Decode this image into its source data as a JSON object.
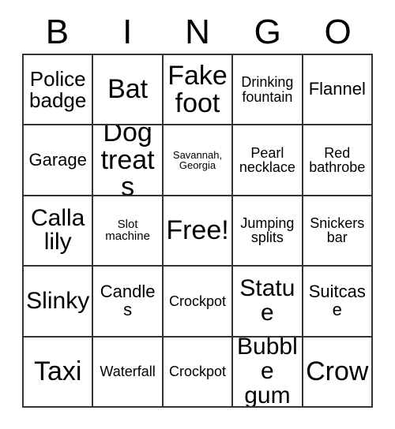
{
  "card": {
    "title": "BINGO",
    "headers": [
      "B",
      "I",
      "N",
      "G",
      "O"
    ],
    "colors": {
      "text": "#000000",
      "border": "#333333",
      "background": "#ffffff"
    },
    "rows": [
      [
        {
          "label": "Police badge",
          "size": "lg"
        },
        {
          "label": "Bat",
          "size": "xxl"
        },
        {
          "label": "Fake foot",
          "size": "xxl"
        },
        {
          "label": "Drinking fountain",
          "size": "sm"
        },
        {
          "label": "Flannel",
          "size": "md"
        }
      ],
      [
        {
          "label": "Garage",
          "size": "md"
        },
        {
          "label": "Dog treats",
          "size": "xxl"
        },
        {
          "label": "Savannah, Georgia",
          "size": "xxs"
        },
        {
          "label": "Pearl necklace",
          "size": "sm"
        },
        {
          "label": "Red bathrobe",
          "size": "sm"
        }
      ],
      [
        {
          "label": "Calla lily",
          "size": "xl"
        },
        {
          "label": "Slot machine",
          "size": "xs"
        },
        {
          "label": "Free!",
          "size": "xxl"
        },
        {
          "label": "Jumping splits",
          "size": "sm"
        },
        {
          "label": "Snickers bar",
          "size": "sm"
        }
      ],
      [
        {
          "label": "Slinky",
          "size": "xl"
        },
        {
          "label": "Candles",
          "size": "md"
        },
        {
          "label": "Crockpot",
          "size": "sm"
        },
        {
          "label": "Statue",
          "size": "xl"
        },
        {
          "label": "Suitcase",
          "size": "md"
        }
      ],
      [
        {
          "label": "Taxi",
          "size": "xxl"
        },
        {
          "label": "Waterfall",
          "size": "sm"
        },
        {
          "label": "Crockpot",
          "size": "sm"
        },
        {
          "label": "Bubble gum",
          "size": "xl"
        },
        {
          "label": "Crow",
          "size": "xxl"
        }
      ]
    ]
  }
}
